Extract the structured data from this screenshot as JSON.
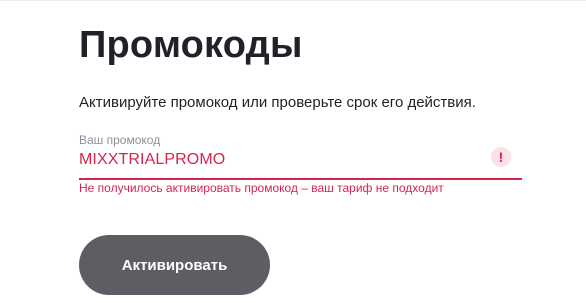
{
  "page": {
    "title": "Промокоды",
    "subtitle": "Активируйте промокод или проверьте срок его действия."
  },
  "promo_field": {
    "label": "Ваш промокод",
    "value": "MIXXTRIALPROMO",
    "error_icon_glyph": "!",
    "error_message": "Не получилось активировать промокод – ваш тариф не подходит"
  },
  "actions": {
    "activate_label": "Активировать"
  },
  "colors": {
    "error": "#d6254d",
    "button_bg": "#5c5e64",
    "text": "#1f2229",
    "label": "#8c9099"
  },
  "icons": {
    "error": "exclamation-circle-icon"
  }
}
